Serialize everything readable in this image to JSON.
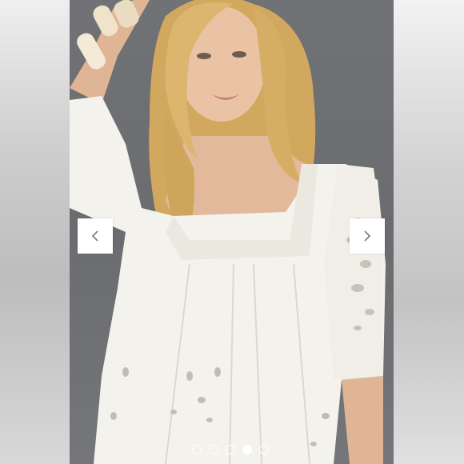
{
  "carousel": {
    "prev_icon": "chevron-left-icon",
    "next_icon": "chevron-right-icon",
    "dots": [
      {
        "active": false
      },
      {
        "active": false
      },
      {
        "active": false
      },
      {
        "active": true
      },
      {
        "active": false
      }
    ],
    "active_index": 3
  },
  "colors": {
    "backdrop": "#6e7073",
    "button_bg": "#ffffff",
    "chevron": "#6b6b6b",
    "dress": "#f4f2ec",
    "hair": "#d8b06a",
    "skin": "#e2b99a"
  }
}
